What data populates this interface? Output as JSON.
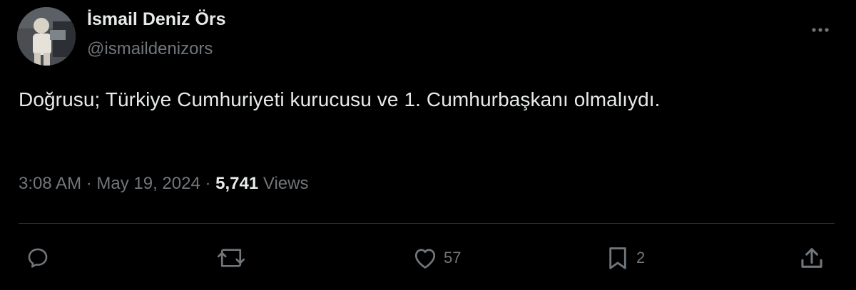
{
  "author": {
    "display_name": "İsmail Deniz Örs",
    "handle": "@ismaildenizors"
  },
  "tweet": {
    "text": "Doğrusu; Türkiye Cumhuriyeti kurucusu ve 1. Cumhurbaşkanı olmalıydı."
  },
  "meta": {
    "time": "3:08 AM",
    "separator": " · ",
    "date": "May 19, 2024",
    "views_count": "5,741",
    "views_label": " Views"
  },
  "actions": {
    "reply_count": "",
    "retweet_count": "",
    "like_count": "57",
    "bookmark_count": "2"
  },
  "icons": {
    "more": "more-options-icon",
    "reply": "reply-icon",
    "retweet": "retweet-icon",
    "like": "heart-icon",
    "bookmark": "bookmark-icon",
    "share": "share-icon"
  },
  "colors": {
    "background": "#000000",
    "primary_text": "#e7e9ea",
    "secondary_text": "#71767b",
    "divider": "#2f3336"
  }
}
